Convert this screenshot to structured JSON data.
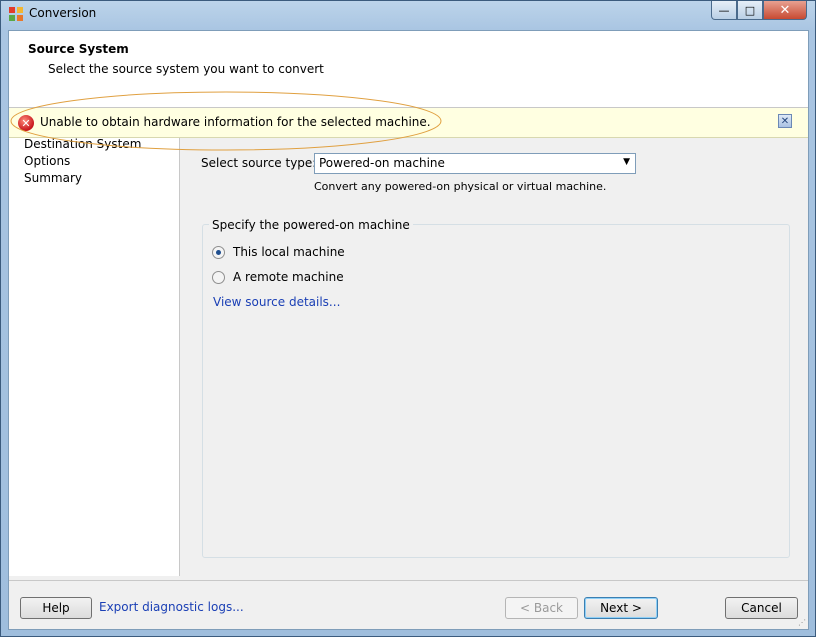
{
  "window": {
    "title": "Conversion"
  },
  "header": {
    "title": "Source System",
    "subtitle": "Select the source system you want to convert"
  },
  "error": {
    "message": "Unable to obtain hardware information for the selected machine."
  },
  "nav": {
    "items": [
      "Destination System",
      "Options",
      "Summary"
    ]
  },
  "source": {
    "label": "Select source type:",
    "selected": "Powered-on machine",
    "help": "Convert any powered-on physical or virtual machine."
  },
  "group": {
    "title": "Specify the powered-on machine",
    "options": [
      {
        "label": "This local machine",
        "selected": true
      },
      {
        "label": "A remote machine",
        "selected": false
      }
    ],
    "link": "View source details..."
  },
  "footer": {
    "help": "Help",
    "export": "Export diagnostic logs...",
    "back": "< Back",
    "next": "Next >",
    "cancel": "Cancel"
  },
  "colors": {
    "error_bg": "#ffffe1",
    "link": "#1a3fb5",
    "annotation": "#e0a040"
  }
}
